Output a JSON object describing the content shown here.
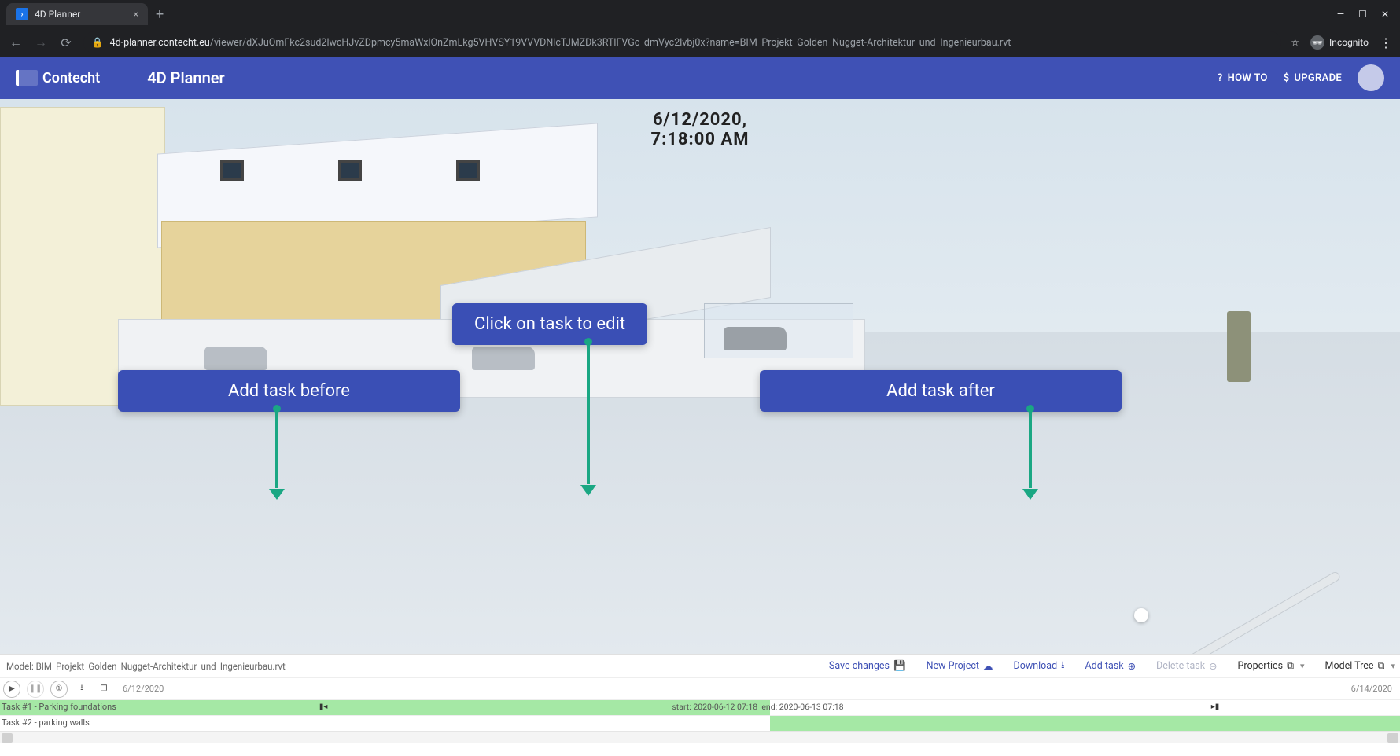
{
  "browser": {
    "tab_title": "4D Planner",
    "url_host": "4d-planner.contecht.eu",
    "url_path": "/viewer/dXJuOmFkc2sud2lwcHJvZDpmcy5maWxlOnZmLkg5VHVSY19VVVDNlcTJMZDk3RTlFVGc_dmVyc2lvbj0x?name=BIM_Projekt_Golden_Nugget-Architektur_und_Ingenieurbau.rvt",
    "incognito_label": "Incognito"
  },
  "header": {
    "logo_text": "Contecht",
    "app_title": "4D Planner",
    "how_to": "HOW TO",
    "upgrade": "UPGRADE"
  },
  "viewer": {
    "date_line": "6/12/2020,",
    "time_line": "7:18:00 AM",
    "callout_edit": "Click on task to edit",
    "callout_before": "Add task before",
    "callout_after": "Add task after"
  },
  "toolbar": {
    "model_label": "Model: BIM_Projekt_Golden_Nugget-Architektur_und_Ingenieurbau.rvt",
    "save": "Save changes",
    "new_project": "New Project",
    "download": "Download",
    "add_task": "Add task",
    "delete_task": "Delete task",
    "properties": "Properties",
    "model_tree": "Model Tree"
  },
  "timeline": {
    "start_date": "6/12/2020",
    "end_date": "6/14/2020",
    "task1_label": "Task #1 - Parking foundations",
    "task2_label": "Task #2 - parking walls",
    "task1_start": "start: 2020-06-12 07:18",
    "task1_end": "end: 2020-06-13 07:18"
  }
}
